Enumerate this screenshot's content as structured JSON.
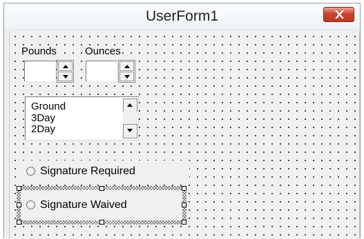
{
  "window": {
    "title": "UserForm1"
  },
  "labels": {
    "pounds": "Pounds",
    "ounces": "Ounces"
  },
  "pounds_spinner": {
    "value": ""
  },
  "ounces_spinner": {
    "value": ""
  },
  "listbox": {
    "items": [
      "Ground",
      "3Day",
      "2Day"
    ]
  },
  "options": {
    "signature_required": "Signature Required",
    "signature_waived": "Signature Waived"
  },
  "colors": {
    "form_background": "#f0f0f0",
    "close_button": "#c7442d",
    "grid_dots": "#000000"
  },
  "icons": {
    "close": "close-x-icon",
    "spin_up": "triangle-up-icon",
    "spin_down": "triangle-down-icon"
  }
}
